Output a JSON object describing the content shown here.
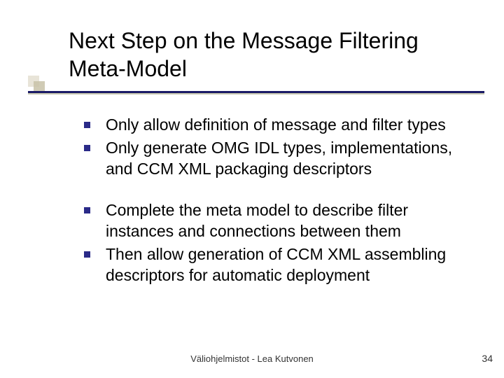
{
  "title": "Next Step on the Message Filtering Meta-Model",
  "bullets": {
    "group1": [
      "Only allow definition of message and filter types",
      "Only generate OMG IDL types, implementations, and CCM XML packaging descriptors"
    ],
    "group2": [
      "Complete the meta model to describe filter instances and connections between them",
      "Then allow generation of CCM XML assembling descriptors for automatic deployment"
    ]
  },
  "footer": "Väliohjelmistot - Lea Kutvonen",
  "page": "34",
  "colors": {
    "rule_dark": "#1a1a66",
    "bullet_square": "#2a2a88"
  }
}
